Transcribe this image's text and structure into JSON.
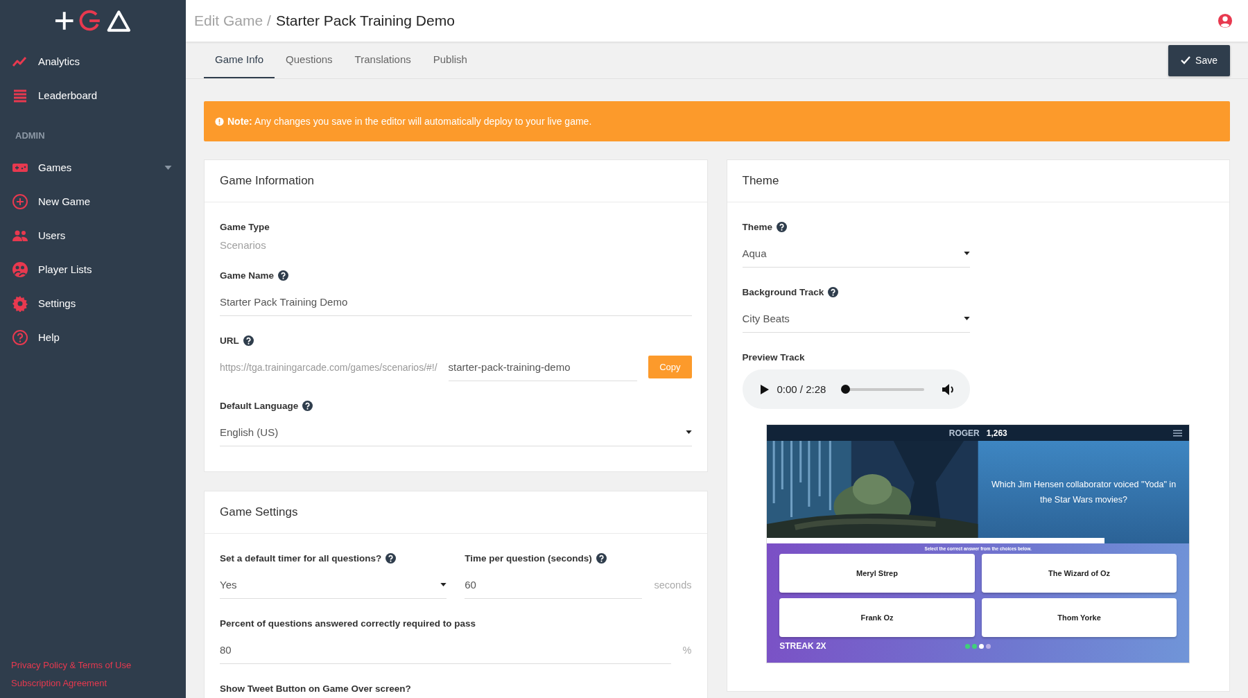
{
  "sidebar": {
    "top_items": [
      {
        "label": "Analytics"
      },
      {
        "label": "Leaderboard"
      }
    ],
    "section_heading": "ADMIN",
    "admin_items": [
      {
        "label": "Games",
        "kind": "menu"
      },
      {
        "label": "New Game",
        "kind": "link"
      },
      {
        "label": "Users",
        "kind": "link"
      },
      {
        "label": "Player Lists",
        "kind": "link"
      },
      {
        "label": "Settings",
        "kind": "link"
      },
      {
        "label": "Help",
        "kind": "link"
      }
    ],
    "footer_links": [
      "Privacy Policy & Terms of Use",
      "Subscription Agreement"
    ]
  },
  "header": {
    "parent": "Edit Game /",
    "current": "Starter Pack Training Demo"
  },
  "tabs": [
    {
      "label": "Game Info",
      "selected": true
    },
    {
      "label": "Questions",
      "selected": false
    },
    {
      "label": "Translations",
      "selected": false
    },
    {
      "label": "Publish",
      "selected": false
    }
  ],
  "save_button": "Save",
  "notice": "**Note:** Any changes you save in the editor will automatically deploy to your live game.",
  "game_information": {
    "title": "Game Information",
    "fields": [
      {
        "kind": "static",
        "label": "Game Type",
        "help": false,
        "value": "Scenarios"
      },
      {
        "kind": "text",
        "label": "Game Name",
        "help": true,
        "value": "Starter Pack Training Demo"
      },
      {
        "kind": "url",
        "label": "URL",
        "help": true,
        "prefix": "https://tga.trainingarcade.com/games/scenarios/#!/",
        "value": "starter-pack-training-demo",
        "button": "Copy"
      },
      {
        "kind": "select",
        "label": "Default Language",
        "help": true,
        "value": "English (US)"
      }
    ]
  },
  "game_settings": {
    "title": "Game Settings",
    "rows": [
      [
        {
          "kind": "select",
          "label": "Set a default timer for all questions?",
          "help": true,
          "value": "Yes"
        },
        {
          "kind": "text",
          "label": "Time per question (seconds)",
          "help": true,
          "value": "60",
          "suffix": "seconds"
        }
      ],
      [
        {
          "kind": "text",
          "label": "Percent of questions answered correctly required to pass",
          "help": false,
          "value": "80",
          "suffix": "%"
        }
      ],
      [
        {
          "kind": "label",
          "label": "Show Tweet Button on Game Over screen?",
          "help": false
        }
      ]
    ]
  },
  "theme": {
    "title": "Theme",
    "fields": [
      {
        "kind": "select",
        "label": "Theme",
        "help": true,
        "value": "Aqua"
      },
      {
        "kind": "select",
        "label": "Background Track",
        "help": true,
        "value": "City Beats"
      }
    ],
    "preview_track": {
      "label": "Preview Track",
      "time": "0:00 / 2:28",
      "level": 0
    },
    "game_preview": {
      "player": "ROGER",
      "score": "1,263",
      "question": "Which Jim Hensen collaborator voiced \"Yoda\" in the Star Wars movies?",
      "progress": {
        "level": 0.8
      },
      "instruction": "Select the correct answer from the choices below.",
      "answers": [
        "Meryl Strep",
        "The Wizard of Oz",
        "Frank Oz",
        "Thom Yorke"
      ],
      "streak": "STREAK 2X",
      "dots": [
        {
          "kind": "correct"
        },
        {
          "kind": "correct"
        },
        {
          "kind": "current"
        },
        {
          "kind": "upcoming"
        }
      ]
    }
  }
}
